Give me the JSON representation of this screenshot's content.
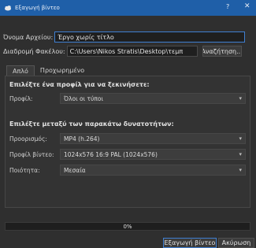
{
  "window": {
    "title": "Εξαγωγή βίντεο",
    "help": "?",
    "close": "✕",
    "accent": "#1f5fa8"
  },
  "file": {
    "name_label": "Όνομα Αρχείου:",
    "name_value": "Έργο χωρίς τίτλο",
    "folder_label": "Διαδρομή Φακέλου:",
    "folder_value": "C:\\Users\\Nikos Stratis\\Desktop\\τεμπ",
    "browse_label": "Αναζήτηση..."
  },
  "tabs": [
    {
      "label": "Απλό",
      "active": true
    },
    {
      "label": "Προχωρημένο",
      "active": false
    }
  ],
  "profile": {
    "section_title": "Επιλέξτε ένα προφίλ για να ξεκινήσετε:",
    "label": "Προφίλ:",
    "value": "Όλοι οι τύποι"
  },
  "options": {
    "section_title": "Επιλέξτε μεταξύ των παρακάτω δυνατοτήτων:",
    "target_label": "Προορισμός:",
    "target_value": "MP4 (h.264)",
    "video_profile_label": "Προφίλ βίντεο:",
    "video_profile_value": "1024x576 16:9 PAL (1024x576)",
    "quality_label": "Ποιότητα:",
    "quality_value": "Μεσαία"
  },
  "progress": {
    "text": "0%",
    "fraction": 0
  },
  "buttons": {
    "export": "Εξαγωγή βίντεο",
    "cancel": "Ακύρωση"
  }
}
